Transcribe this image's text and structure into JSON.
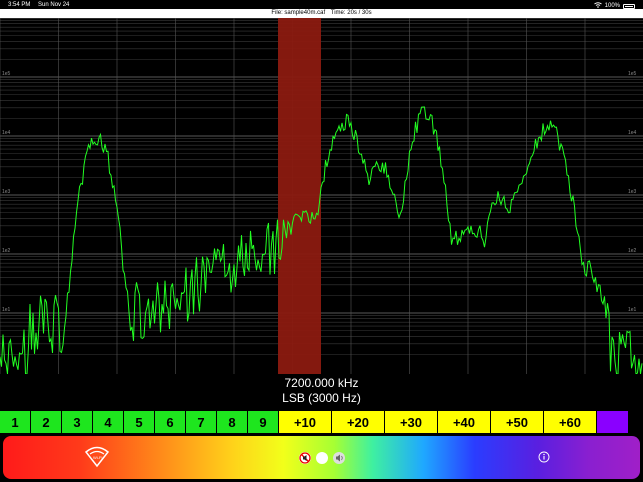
{
  "status": {
    "time": "3:54 PM",
    "date": "Sun Nov 24",
    "battery": "100%"
  },
  "file": {
    "name_label": "File: sample40m.caf",
    "time_label": "Time: 20s /  30s"
  },
  "spectrum": {
    "log_labels": [
      "1e5",
      "1e4",
      "1e3",
      "1e2",
      "1e1"
    ],
    "trace_color": "#22ff22",
    "band_color": "#8b1a10"
  },
  "tuning": {
    "frequency": "7200.000 kHz",
    "mode": "LSB (3000 Hz)"
  },
  "s_meter": [
    {
      "label": "1",
      "color": "#1ee61e"
    },
    {
      "label": "2",
      "color": "#1ee61e"
    },
    {
      "label": "3",
      "color": "#1ee61e"
    },
    {
      "label": "4",
      "color": "#1ee61e"
    },
    {
      "label": "5",
      "color": "#1ee61e"
    },
    {
      "label": "6",
      "color": "#1ee61e"
    },
    {
      "label": "7",
      "color": "#1ee61e"
    },
    {
      "label": "8",
      "color": "#1ee61e"
    },
    {
      "label": "9",
      "color": "#1ee61e"
    },
    {
      "label": "+10",
      "color": "#ffff00"
    },
    {
      "label": "+20",
      "color": "#ffff00"
    },
    {
      "label": "+30",
      "color": "#ffff00"
    },
    {
      "label": "+40",
      "color": "#ffff00"
    },
    {
      "label": "+50",
      "color": "#ffff00"
    },
    {
      "label": "+60",
      "color": "#ffff00"
    },
    {
      "label": "",
      "color": "#8a00ff"
    }
  ],
  "controls": {
    "info_icon": "info-icon",
    "wifi_icon": "wifi-logo-icon",
    "mute_icon": "mute-icon",
    "volume_icon": "volume-icon"
  }
}
